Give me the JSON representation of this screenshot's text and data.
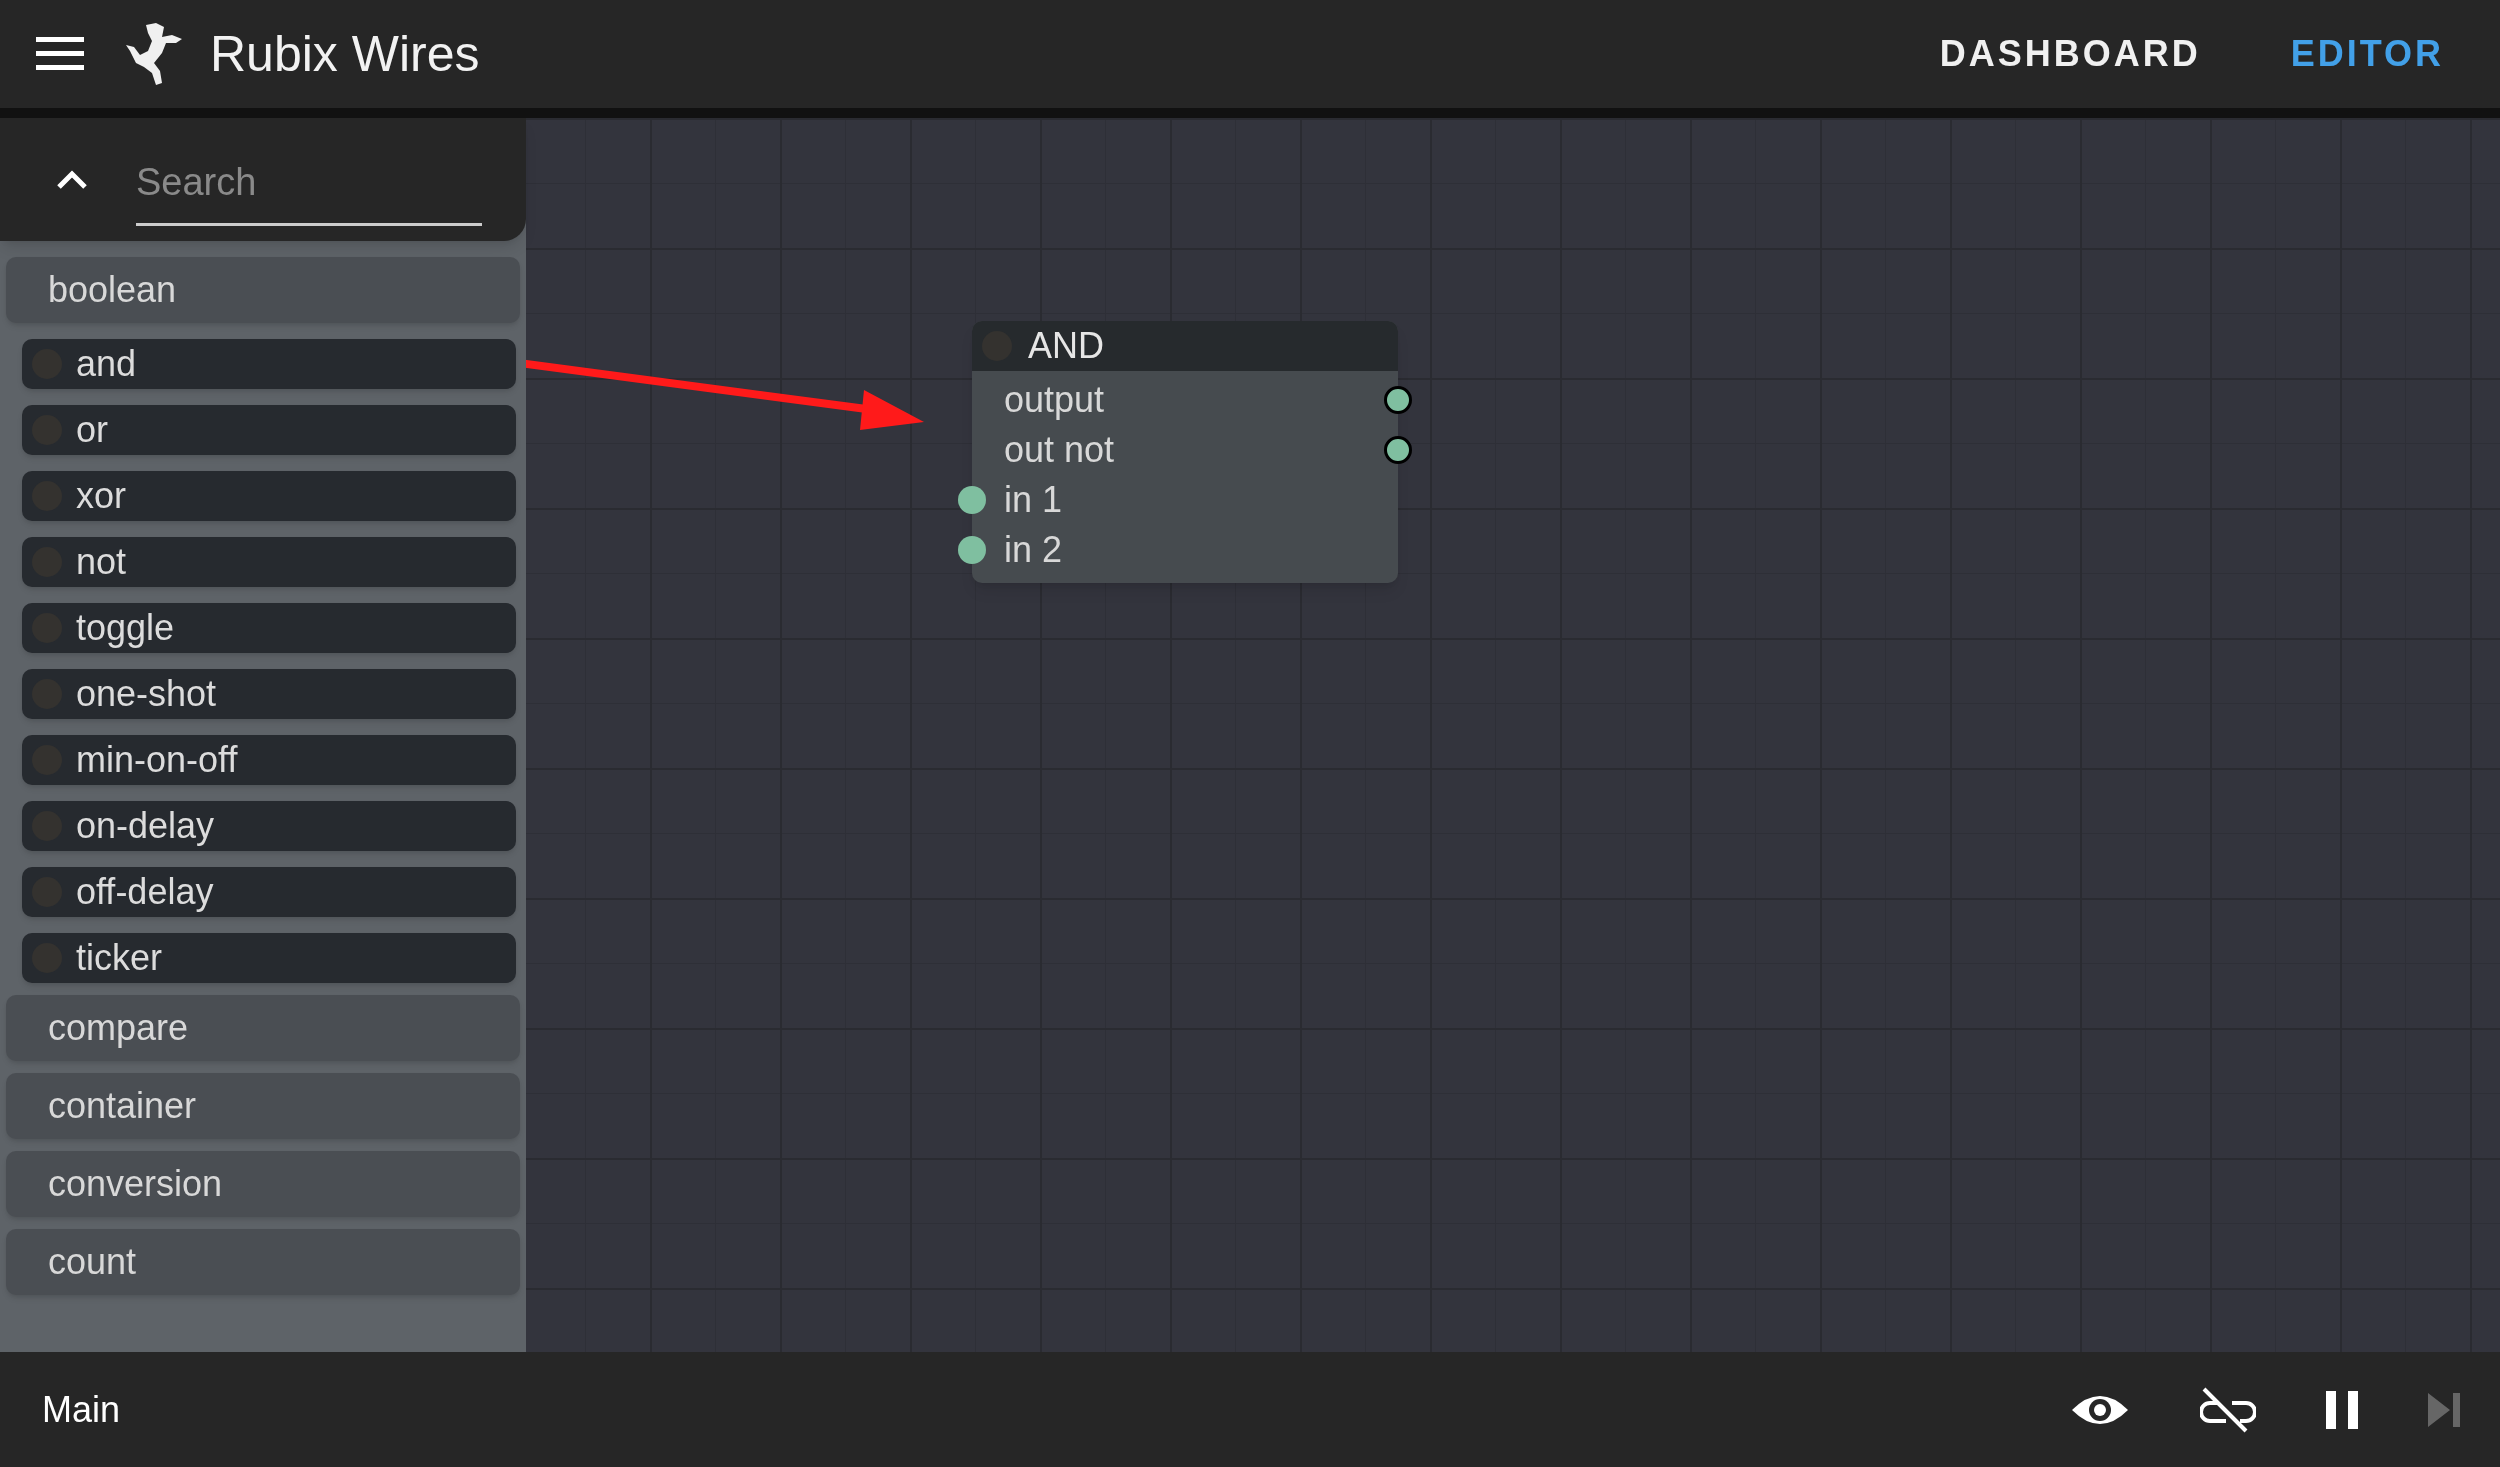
{
  "app_bar": {
    "title": "Rubix Wires",
    "nav": [
      {
        "label": "DASHBOARD",
        "selected": false
      },
      {
        "label": "EDITOR",
        "selected": true
      }
    ]
  },
  "palette": {
    "search": {
      "placeholder": "Search"
    },
    "expanded": true,
    "categories": [
      {
        "label": "boolean",
        "children": [
          {
            "label": "and"
          },
          {
            "label": "or"
          },
          {
            "label": "xor"
          },
          {
            "label": "not"
          },
          {
            "label": "toggle"
          },
          {
            "label": "one-shot"
          },
          {
            "label": "min-on-off"
          },
          {
            "label": "on-delay"
          },
          {
            "label": "off-delay"
          },
          {
            "label": "ticker"
          }
        ]
      },
      {
        "label": "compare"
      },
      {
        "label": "container"
      },
      {
        "label": "conversion"
      },
      {
        "label": "count"
      }
    ]
  },
  "node": {
    "title": "AND",
    "ports": [
      {
        "label": "output",
        "kind": "output",
        "color": "#7fbfa0"
      },
      {
        "label": "out not",
        "kind": "output",
        "color": "#7fbfa0"
      },
      {
        "label": "in 1",
        "kind": "input",
        "color": "#7fbfa0"
      },
      {
        "label": "in 2",
        "kind": "input",
        "color": "#7fbfa0"
      }
    ]
  },
  "status_bar": {
    "label": "Main",
    "step_disabled": true
  }
}
